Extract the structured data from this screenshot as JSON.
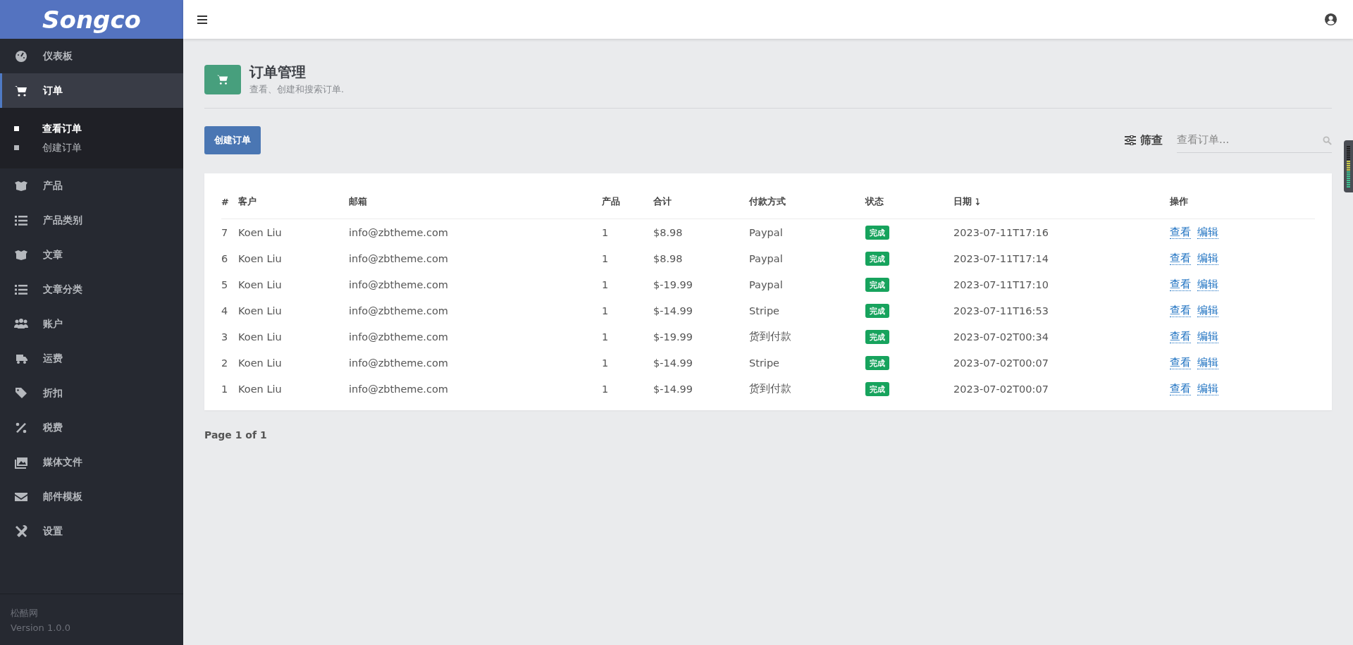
{
  "brand": "Songco",
  "sidebar": {
    "items": [
      {
        "label": "仪表板",
        "selected": false
      },
      {
        "label": "订单",
        "selected": true,
        "expanded": true,
        "children": [
          {
            "label": "查看订单",
            "selected": true
          },
          {
            "label": "创建订单",
            "selected": false
          }
        ]
      },
      {
        "label": "产品",
        "selected": false
      },
      {
        "label": "产品类别",
        "selected": false
      },
      {
        "label": "文章",
        "selected": false
      },
      {
        "label": "文章分类",
        "selected": false
      },
      {
        "label": "账户",
        "selected": false
      },
      {
        "label": "运费",
        "selected": false
      },
      {
        "label": "折扣",
        "selected": false
      },
      {
        "label": "税费",
        "selected": false
      },
      {
        "label": "媒体文件",
        "selected": false
      },
      {
        "label": "邮件模板",
        "selected": false
      },
      {
        "label": "设置",
        "selected": false
      }
    ],
    "footer": {
      "site": "松酷网",
      "version": "Version 1.0.0"
    }
  },
  "page_header": {
    "title": "订单管理",
    "subtitle": "查看、创建和搜索订单."
  },
  "create_button": "创建订单",
  "filter_button": "筛查",
  "search": {
    "placeholder": "查看订单..."
  },
  "table": {
    "columns": [
      {
        "label": "#",
        "sorted": false
      },
      {
        "label": "客户",
        "sorted": false
      },
      {
        "label": "邮箱",
        "sorted": false
      },
      {
        "label": "产品",
        "sorted": false
      },
      {
        "label": "合计",
        "sorted": false
      },
      {
        "label": "付款方式",
        "sorted": false
      },
      {
        "label": "状态",
        "sorted": false
      },
      {
        "label": "日期",
        "sorted": true
      },
      {
        "label": "操作",
        "sorted": false
      }
    ],
    "rows": [
      {
        "id": "7",
        "customer": "Koen Liu",
        "email": "info@zbtheme.com",
        "products": "1",
        "total": "$8.98",
        "payment": "Paypal",
        "status": "完成",
        "date": "2023-07-11T17:16",
        "actions": [
          "查看",
          "编辑"
        ]
      },
      {
        "id": "6",
        "customer": "Koen Liu",
        "email": "info@zbtheme.com",
        "products": "1",
        "total": "$8.98",
        "payment": "Paypal",
        "status": "完成",
        "date": "2023-07-11T17:14",
        "actions": [
          "查看",
          "编辑"
        ]
      },
      {
        "id": "5",
        "customer": "Koen Liu",
        "email": "info@zbtheme.com",
        "products": "1",
        "total": "$-19.99",
        "payment": "Paypal",
        "status": "完成",
        "date": "2023-07-11T17:10",
        "actions": [
          "查看",
          "编辑"
        ]
      },
      {
        "id": "4",
        "customer": "Koen Liu",
        "email": "info@zbtheme.com",
        "products": "1",
        "total": "$-14.99",
        "payment": "Stripe",
        "status": "完成",
        "date": "2023-07-11T16:53",
        "actions": [
          "查看",
          "编辑"
        ]
      },
      {
        "id": "3",
        "customer": "Koen Liu",
        "email": "info@zbtheme.com",
        "products": "1",
        "total": "$-19.99",
        "payment": "货到付款",
        "status": "完成",
        "date": "2023-07-02T00:34",
        "actions": [
          "查看",
          "编辑"
        ]
      },
      {
        "id": "2",
        "customer": "Koen Liu",
        "email": "info@zbtheme.com",
        "products": "1",
        "total": "$-14.99",
        "payment": "Stripe",
        "status": "完成",
        "date": "2023-07-02T00:07",
        "actions": [
          "查看",
          "编辑"
        ]
      },
      {
        "id": "1",
        "customer": "Koen Liu",
        "email": "info@zbtheme.com",
        "products": "1",
        "total": "$-14.99",
        "payment": "货到付款",
        "status": "完成",
        "date": "2023-07-02T00:07",
        "actions": [
          "查看",
          "编辑"
        ]
      }
    ]
  },
  "pagination": "Page 1 of 1"
}
